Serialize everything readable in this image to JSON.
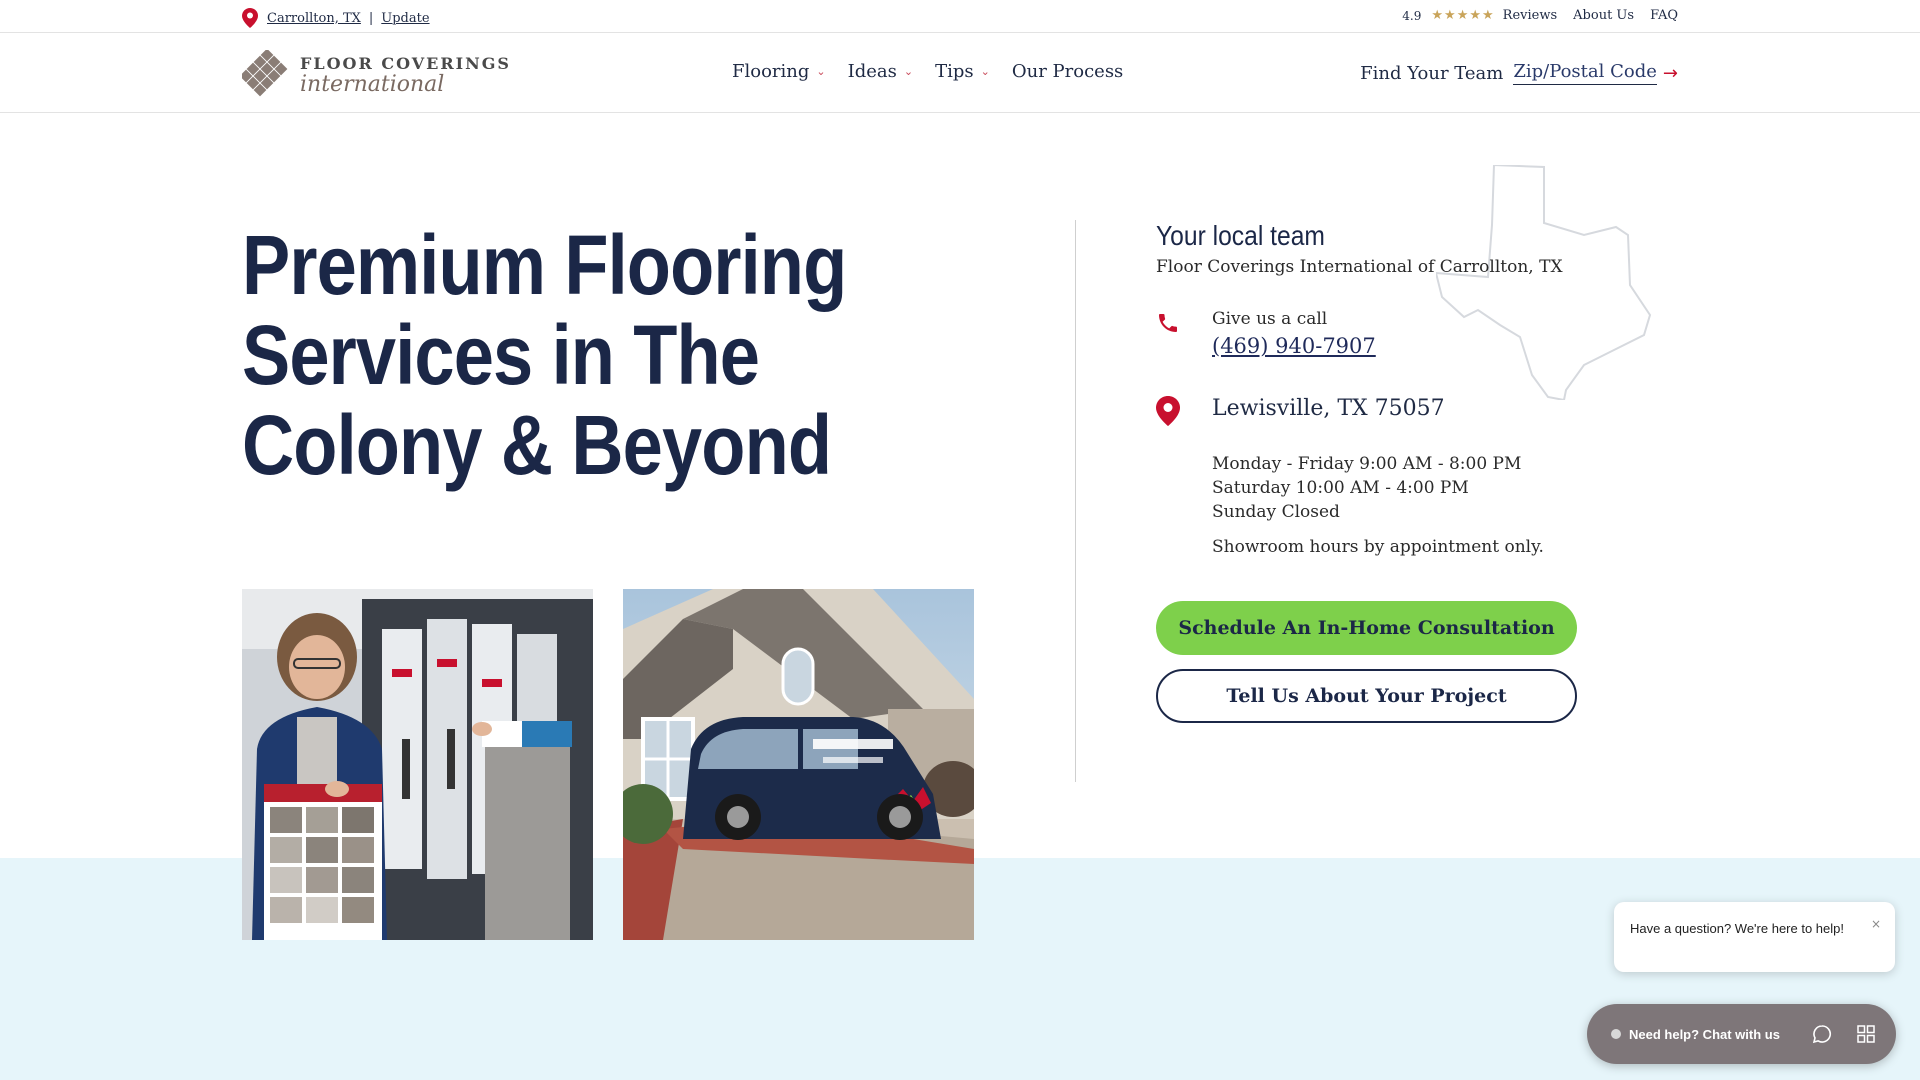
{
  "utility": {
    "location": "Carrollton, TX",
    "separator": "|",
    "update": "Update",
    "rating": "4.9",
    "stars": "★★★★★",
    "reviews": "Reviews",
    "about": "About Us",
    "faq": "FAQ"
  },
  "logo": {
    "top": "FLOOR COVERINGS",
    "bottom": "international"
  },
  "nav": {
    "items": [
      {
        "label": "Flooring",
        "has_dropdown": true
      },
      {
        "label": "Ideas",
        "has_dropdown": true
      },
      {
        "label": "Tips",
        "has_dropdown": true
      },
      {
        "label": "Our Process",
        "has_dropdown": false
      }
    ],
    "chevron": "⌄"
  },
  "find_team": {
    "label": "Find Your Team",
    "zip_link": "Zip/Postal Code",
    "arrow": "→"
  },
  "hero": {
    "title": "Premium Flooring Services in The Colony & Beyond"
  },
  "local": {
    "heading": "Your local team",
    "subtitle": "Floor Coverings International of Carrollton, TX",
    "call_label": "Give us a call",
    "phone": "(469) 940-7907",
    "address": "Lewisville, TX 75057",
    "hours": [
      "Monday - Friday 9:00 AM - 8:00 PM",
      "Saturday 10:00 AM - 4:00 PM",
      "Sunday Closed"
    ],
    "showroom": "Showroom hours by appointment only."
  },
  "buttons": {
    "primary": "Schedule An In-Home Consultation",
    "secondary": "Tell Us About Your Project"
  },
  "chat": {
    "bubble": "Have a question? We're here to help!",
    "close": "×",
    "bar": "Need help? Chat with us"
  },
  "colors": {
    "navy": "#1b2747",
    "accent_red": "#c8102e",
    "cta_green": "#7ed04b",
    "band_blue": "#e6f5fa"
  },
  "icons": [
    "location-pin-icon",
    "phone-icon",
    "chevron-down-icon",
    "arrow-right-icon",
    "texas-outline-icon",
    "chat-icon",
    "apps-grid-icon",
    "close-icon"
  ]
}
